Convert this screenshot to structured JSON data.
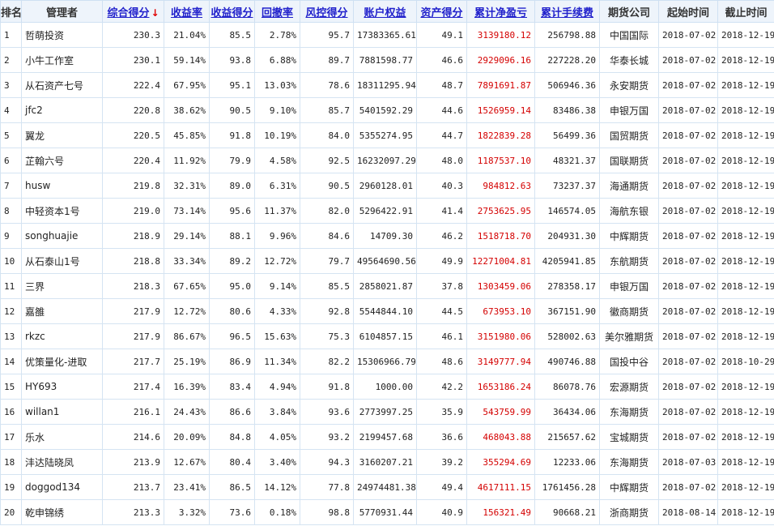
{
  "columns": [
    {
      "label": "排名",
      "sortable": false
    },
    {
      "label": "管理者",
      "sortable": false
    },
    {
      "label": "综合得分",
      "sortable": true,
      "sorted_desc": true
    },
    {
      "label": "收益率",
      "sortable": true
    },
    {
      "label": "收益得分",
      "sortable": true
    },
    {
      "label": "回撤率",
      "sortable": true
    },
    {
      "label": "风控得分",
      "sortable": true
    },
    {
      "label": "账户权益",
      "sortable": true
    },
    {
      "label": "资产得分",
      "sortable": true
    },
    {
      "label": "累计净盈亏",
      "sortable": true
    },
    {
      "label": "累计手续费",
      "sortable": true
    },
    {
      "label": "期货公司",
      "sortable": false
    },
    {
      "label": "起始时间",
      "sortable": false
    },
    {
      "label": "截止时间",
      "sortable": false
    }
  ],
  "sort_arrow": "↓",
  "rows": [
    [
      "1",
      "哲萌投资",
      "230.3",
      "21.04%",
      "85.5",
      "2.78%",
      "95.7",
      "17383365.61",
      "49.1",
      "3139180.12",
      "256798.88",
      "中国国际",
      "2018-07-02",
      "2018-12-19"
    ],
    [
      "2",
      "小牛工作室",
      "230.1",
      "59.14%",
      "93.8",
      "6.88%",
      "89.7",
      "7881598.77",
      "46.6",
      "2929096.16",
      "227228.20",
      "华泰长城",
      "2018-07-02",
      "2018-12-19"
    ],
    [
      "3",
      "从石资产七号",
      "222.4",
      "67.95%",
      "95.1",
      "13.03%",
      "78.6",
      "18311295.94",
      "48.7",
      "7891691.87",
      "506946.36",
      "永安期货",
      "2018-07-02",
      "2018-12-19"
    ],
    [
      "4",
      "jfc2",
      "220.8",
      "38.62%",
      "90.5",
      "9.10%",
      "85.7",
      "5401592.29",
      "44.6",
      "1526959.14",
      "83486.38",
      "申银万国",
      "2018-07-02",
      "2018-12-19"
    ],
    [
      "5",
      "翼龙",
      "220.5",
      "45.85%",
      "91.8",
      "10.19%",
      "84.0",
      "5355274.95",
      "44.7",
      "1822839.28",
      "56499.36",
      "国贸期货",
      "2018-07-02",
      "2018-12-19"
    ],
    [
      "6",
      "芷翰六号",
      "220.4",
      "11.92%",
      "79.9",
      "4.58%",
      "92.5",
      "16232097.29",
      "48.0",
      "1187537.10",
      "48321.37",
      "国联期货",
      "2018-07-02",
      "2018-12-19"
    ],
    [
      "7",
      "husw",
      "219.8",
      "32.31%",
      "89.0",
      "6.31%",
      "90.5",
      "2960128.01",
      "40.3",
      "984812.63",
      "73237.37",
      "海通期货",
      "2018-07-02",
      "2018-12-19"
    ],
    [
      "8",
      "中轻资本1号",
      "219.0",
      "73.14%",
      "95.6",
      "11.37%",
      "82.0",
      "5296422.91",
      "41.4",
      "2753625.95",
      "146574.05",
      "海航东银",
      "2018-07-02",
      "2018-12-19"
    ],
    [
      "9",
      "songhuajie",
      "218.9",
      "29.14%",
      "88.1",
      "9.96%",
      "84.6",
      "14709.30",
      "46.2",
      "1518718.70",
      "204931.30",
      "中辉期货",
      "2018-07-02",
      "2018-12-19"
    ],
    [
      "10",
      "从石泰山1号",
      "218.8",
      "33.34%",
      "89.2",
      "12.72%",
      "79.7",
      "49564690.56",
      "49.9",
      "12271004.81",
      "4205941.85",
      "东航期货",
      "2018-07-02",
      "2018-12-19"
    ],
    [
      "11",
      "三界",
      "218.3",
      "67.65%",
      "95.0",
      "9.14%",
      "85.5",
      "2858021.87",
      "37.8",
      "1303459.06",
      "278358.17",
      "申银万国",
      "2018-07-02",
      "2018-12-19"
    ],
    [
      "12",
      "嘉雒",
      "217.9",
      "12.72%",
      "80.6",
      "4.33%",
      "92.8",
      "5544844.10",
      "44.5",
      "673953.10",
      "367151.90",
      "徽商期货",
      "2018-07-02",
      "2018-12-19"
    ],
    [
      "13",
      "rkzc",
      "217.9",
      "86.67%",
      "96.5",
      "15.63%",
      "75.3",
      "6104857.15",
      "46.1",
      "3151980.06",
      "528002.63",
      "美尔雅期货",
      "2018-07-02",
      "2018-12-19"
    ],
    [
      "14",
      "优策量化-进取",
      "217.7",
      "25.19%",
      "86.9",
      "11.34%",
      "82.2",
      "15306966.79",
      "48.6",
      "3149777.94",
      "490746.88",
      "国投中谷",
      "2018-07-02",
      "2018-10-29"
    ],
    [
      "15",
      "HY693",
      "217.4",
      "16.39%",
      "83.4",
      "4.94%",
      "91.8",
      "1000.00",
      "42.2",
      "1653186.24",
      "86078.76",
      "宏源期货",
      "2018-07-02",
      "2018-12-19"
    ],
    [
      "16",
      "willan1",
      "216.1",
      "24.43%",
      "86.6",
      "3.84%",
      "93.6",
      "2773997.25",
      "35.9",
      "543759.99",
      "36434.06",
      "东海期货",
      "2018-07-02",
      "2018-12-19"
    ],
    [
      "17",
      "乐水",
      "214.6",
      "20.09%",
      "84.8",
      "4.05%",
      "93.2",
      "2199457.68",
      "36.6",
      "468043.88",
      "215657.62",
      "宝城期货",
      "2018-07-02",
      "2018-12-19"
    ],
    [
      "18",
      "沣达陆晓凤",
      "213.9",
      "12.67%",
      "80.4",
      "3.40%",
      "94.3",
      "3160207.21",
      "39.2",
      "355294.69",
      "12233.06",
      "东海期货",
      "2018-07-03",
      "2018-12-19"
    ],
    [
      "19",
      "doggod134",
      "213.7",
      "23.41%",
      "86.5",
      "14.12%",
      "77.8",
      "24974481.38",
      "49.4",
      "4617111.15",
      "1761456.28",
      "中辉期货",
      "2018-07-02",
      "2018-12-19"
    ],
    [
      "20",
      "乾申锦绣",
      "213.3",
      "3.32%",
      "73.6",
      "0.18%",
      "98.8",
      "5770931.44",
      "40.9",
      "156321.49",
      "90668.21",
      "浙商期货",
      "2018-08-14",
      "2018-12-19"
    ]
  ],
  "colors": {
    "link": "#2222cc",
    "profit": "#d40000",
    "header_bg": "#eef4fb",
    "grid": "#d5e4f2"
  }
}
